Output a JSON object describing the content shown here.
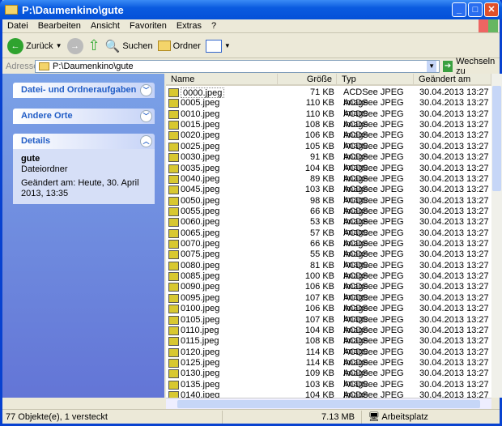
{
  "window": {
    "title": "P:\\Daumenkino\\gute"
  },
  "menu": [
    "Datei",
    "Bearbeiten",
    "Ansicht",
    "Favoriten",
    "Extras",
    "?"
  ],
  "toolbar": {
    "back": "Zurück",
    "search": "Suchen",
    "folders": "Ordner"
  },
  "address": {
    "label": "Adresse",
    "value": "P:\\Daumenkino\\gute",
    "go": "Wechseln zu"
  },
  "sidebar": {
    "tasks": "Datei- und Ordneraufgaben",
    "places": "Andere Orte",
    "details": "Details",
    "detail_name": "gute",
    "detail_type": "Dateiordner",
    "detail_modified": "Geändert am: Heute, 30. April 2013, 13:35"
  },
  "columns": [
    "Name",
    "Größe",
    "Typ",
    "Geändert am"
  ],
  "files": [
    [
      "0000.jpeg",
      "71 KB"
    ],
    [
      "0005.jpeg",
      "110 KB"
    ],
    [
      "0010.jpeg",
      "110 KB"
    ],
    [
      "0015.jpeg",
      "108 KB"
    ],
    [
      "0020.jpeg",
      "106 KB"
    ],
    [
      "0025.jpeg",
      "105 KB"
    ],
    [
      "0030.jpeg",
      "91 KB"
    ],
    [
      "0035.jpeg",
      "104 KB"
    ],
    [
      "0040.jpeg",
      "89 KB"
    ],
    [
      "0045.jpeg",
      "103 KB"
    ],
    [
      "0050.jpeg",
      "98 KB"
    ],
    [
      "0055.jpeg",
      "66 KB"
    ],
    [
      "0060.jpeg",
      "53 KB"
    ],
    [
      "0065.jpeg",
      "57 KB"
    ],
    [
      "0070.jpeg",
      "66 KB"
    ],
    [
      "0075.jpeg",
      "55 KB"
    ],
    [
      "0080.jpeg",
      "81 KB"
    ],
    [
      "0085.jpeg",
      "100 KB"
    ],
    [
      "0090.jpeg",
      "106 KB"
    ],
    [
      "0095.jpeg",
      "107 KB"
    ],
    [
      "0100.jpeg",
      "106 KB"
    ],
    [
      "0105.jpeg",
      "107 KB"
    ],
    [
      "0110.jpeg",
      "104 KB"
    ],
    [
      "0115.jpeg",
      "108 KB"
    ],
    [
      "0120.jpeg",
      "114 KB"
    ],
    [
      "0125.jpeg",
      "114 KB"
    ],
    [
      "0130.jpeg",
      "109 KB"
    ],
    [
      "0135.jpeg",
      "103 KB"
    ],
    [
      "0140.jpeg",
      "104 KB"
    ]
  ],
  "file_type": "ACDSee JPEG Image",
  "file_date": "30.04.2013 13:27",
  "status": {
    "count": "77 Objekte(e), 1 versteckt",
    "size": "7.13 MB",
    "location": "Arbeitsplatz"
  }
}
